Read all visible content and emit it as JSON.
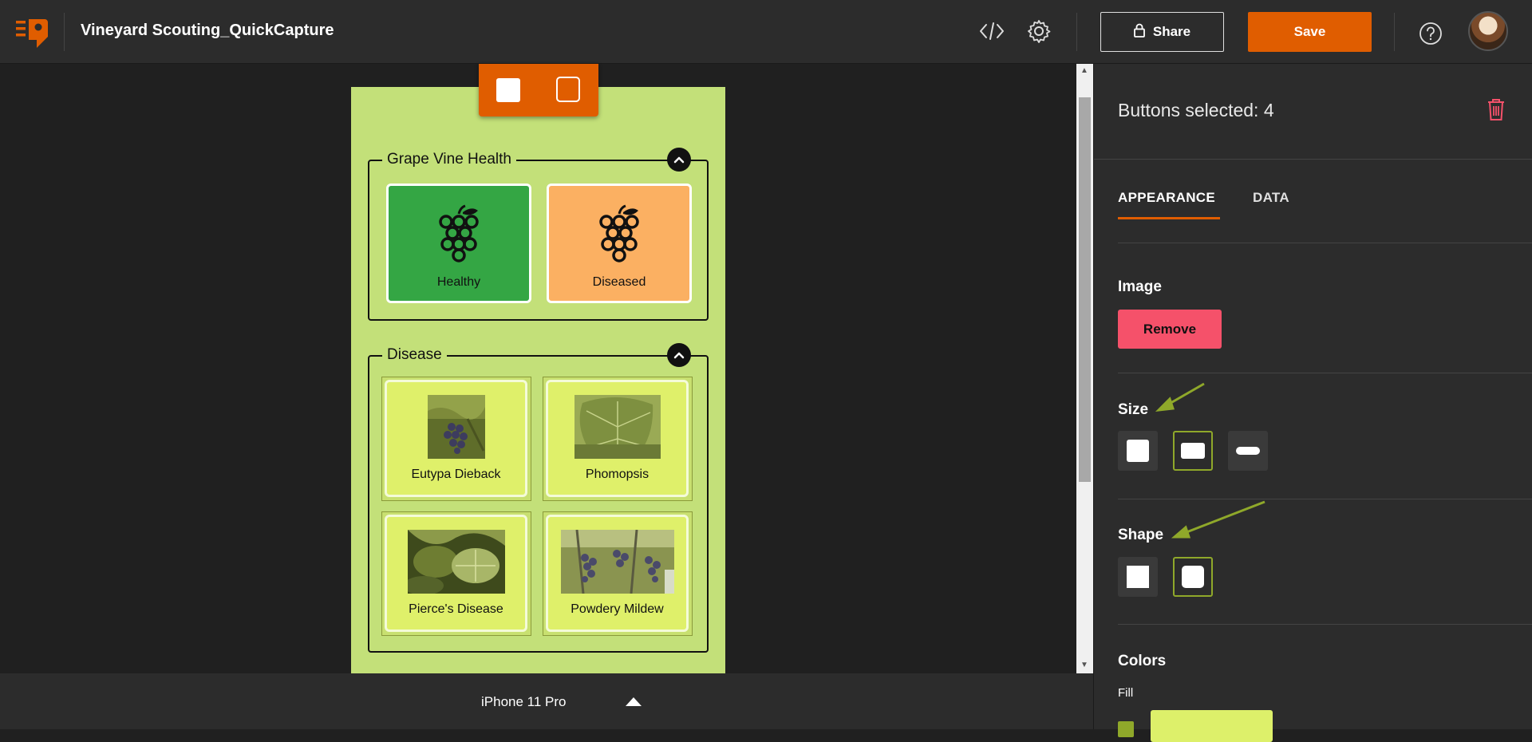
{
  "app": {
    "title": "Vineyard Scouting_QuickCapture",
    "share_label": "Share",
    "save_label": "Save",
    "brand_color": "#e05d00"
  },
  "icons": {
    "logo": "quickcapture-logo-icon",
    "code": "code-icon",
    "settings": "gear-icon",
    "lock": "lock-icon",
    "help": "help-icon",
    "delete": "trash-icon"
  },
  "canvas": {
    "background_color": "#c3e079",
    "groups": [
      {
        "title": "Grape Vine Health",
        "buttons": [
          {
            "label": "Healthy",
            "color": "#34a644",
            "icon": "grapes-icon"
          },
          {
            "label": "Diseased",
            "color": "#fbb062",
            "icon": "grapes-icon"
          }
        ]
      },
      {
        "title": "Disease",
        "buttons": [
          {
            "label": "Eutypa Dieback",
            "image": "grape-cluster-photo"
          },
          {
            "label": "Phomopsis",
            "image": "vine-leaf-photo"
          },
          {
            "label": "Pierce's Disease",
            "image": "leaf-canopy-photo"
          },
          {
            "label": "Powdery Mildew",
            "image": "grape-bunches-photo"
          }
        ]
      }
    ]
  },
  "device": {
    "name": "iPhone 11 Pro"
  },
  "panel": {
    "selection_title": "Buttons selected: 4",
    "tabs": [
      {
        "label": "APPEARANCE",
        "active": true
      },
      {
        "label": "DATA",
        "active": false
      }
    ],
    "image_section": {
      "label": "Image",
      "remove_label": "Remove"
    },
    "size_section": {
      "label": "Size",
      "options": [
        "small",
        "medium",
        "wide"
      ],
      "selected": "medium"
    },
    "shape_section": {
      "label": "Shape",
      "options": [
        "square",
        "rounded"
      ],
      "selected": "rounded"
    },
    "colors_section": {
      "label": "Colors",
      "fill_label": "Fill",
      "fill_color": "#ddf06a"
    },
    "selection_accent": "#8fa82a"
  }
}
